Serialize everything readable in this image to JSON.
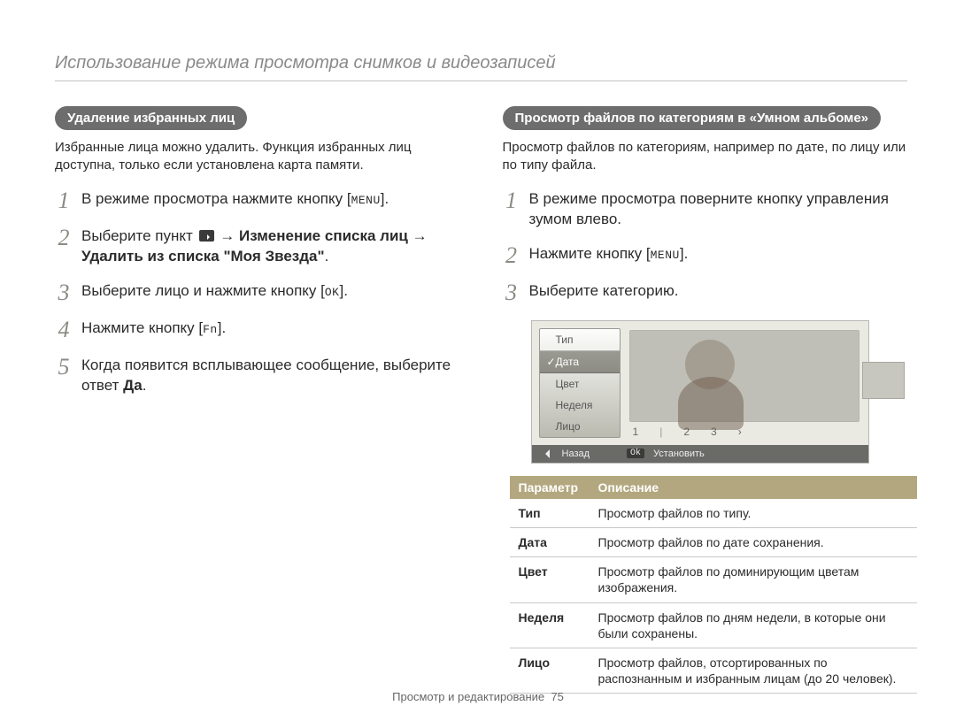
{
  "section_title": "Использование режима просмотра снимков и видеозаписей",
  "left": {
    "pill": "Удаление избранных лиц",
    "intro": "Избранные лица можно удалить. Функция избранных лиц доступна, только если установлена карта памяти.",
    "steps": {
      "s1_a": "В режиме просмотра нажмите кнопку [",
      "s1_b": "].",
      "s2_a": "Выберите пункт ",
      "s2_b": " → ",
      "s2_bold1": "Изменение списка лиц",
      "s2_c": " → ",
      "s2_bold2": "Удалить из списка \"Моя Звезда\"",
      "s2_d": ".",
      "s3_a": "Выберите лицо и нажмите кнопку [",
      "s3_b": "].",
      "s4_a": "Нажмите кнопку [",
      "s4_b": "].",
      "s5_a": "Когда появится всплывающее сообщение, выберите ответ ",
      "s5_bold": "Да",
      "s5_b": "."
    },
    "keys": {
      "menu": "MENU",
      "ok": "OK",
      "fn": "Fn"
    }
  },
  "right": {
    "pill": "Просмотр файлов по категориям в «Умном альбоме»",
    "intro": "Просмотр файлов по категориям, например по дате, по лицу или по типу файла.",
    "steps": {
      "s1": "В режиме просмотра поверните кнопку управления зумом влево.",
      "s2_a": "Нажмите кнопку [",
      "s2_b": "].",
      "s3": "Выберите категорию."
    },
    "keys": {
      "menu": "MENU"
    },
    "screen": {
      "menu_items": [
        "Тип",
        "Дата",
        "Цвет",
        "Неделя",
        "Лицо"
      ],
      "selected_index": 1,
      "pager": [
        "1",
        "2",
        "3"
      ],
      "pager_next": "›",
      "back_label": "Назад",
      "ok_key": "Ok",
      "set_label": "Установить"
    },
    "table": {
      "head_param": "Параметр",
      "head_desc": "Описание",
      "rows": [
        {
          "p": "Тип",
          "d": "Просмотр файлов по типу."
        },
        {
          "p": "Дата",
          "d": "Просмотр файлов по дате сохранения."
        },
        {
          "p": "Цвет",
          "d": "Просмотр файлов по доминирующим цветам изображения."
        },
        {
          "p": "Неделя",
          "d": "Просмотр файлов по дням недели, в которые они были сохранены."
        },
        {
          "p": "Лицо",
          "d": "Просмотр файлов, отсортированных по распознанным и избранным лицам (до 20 человек)."
        }
      ]
    }
  },
  "footer_a": "Просмотр и редактирование",
  "footer_b": "75"
}
